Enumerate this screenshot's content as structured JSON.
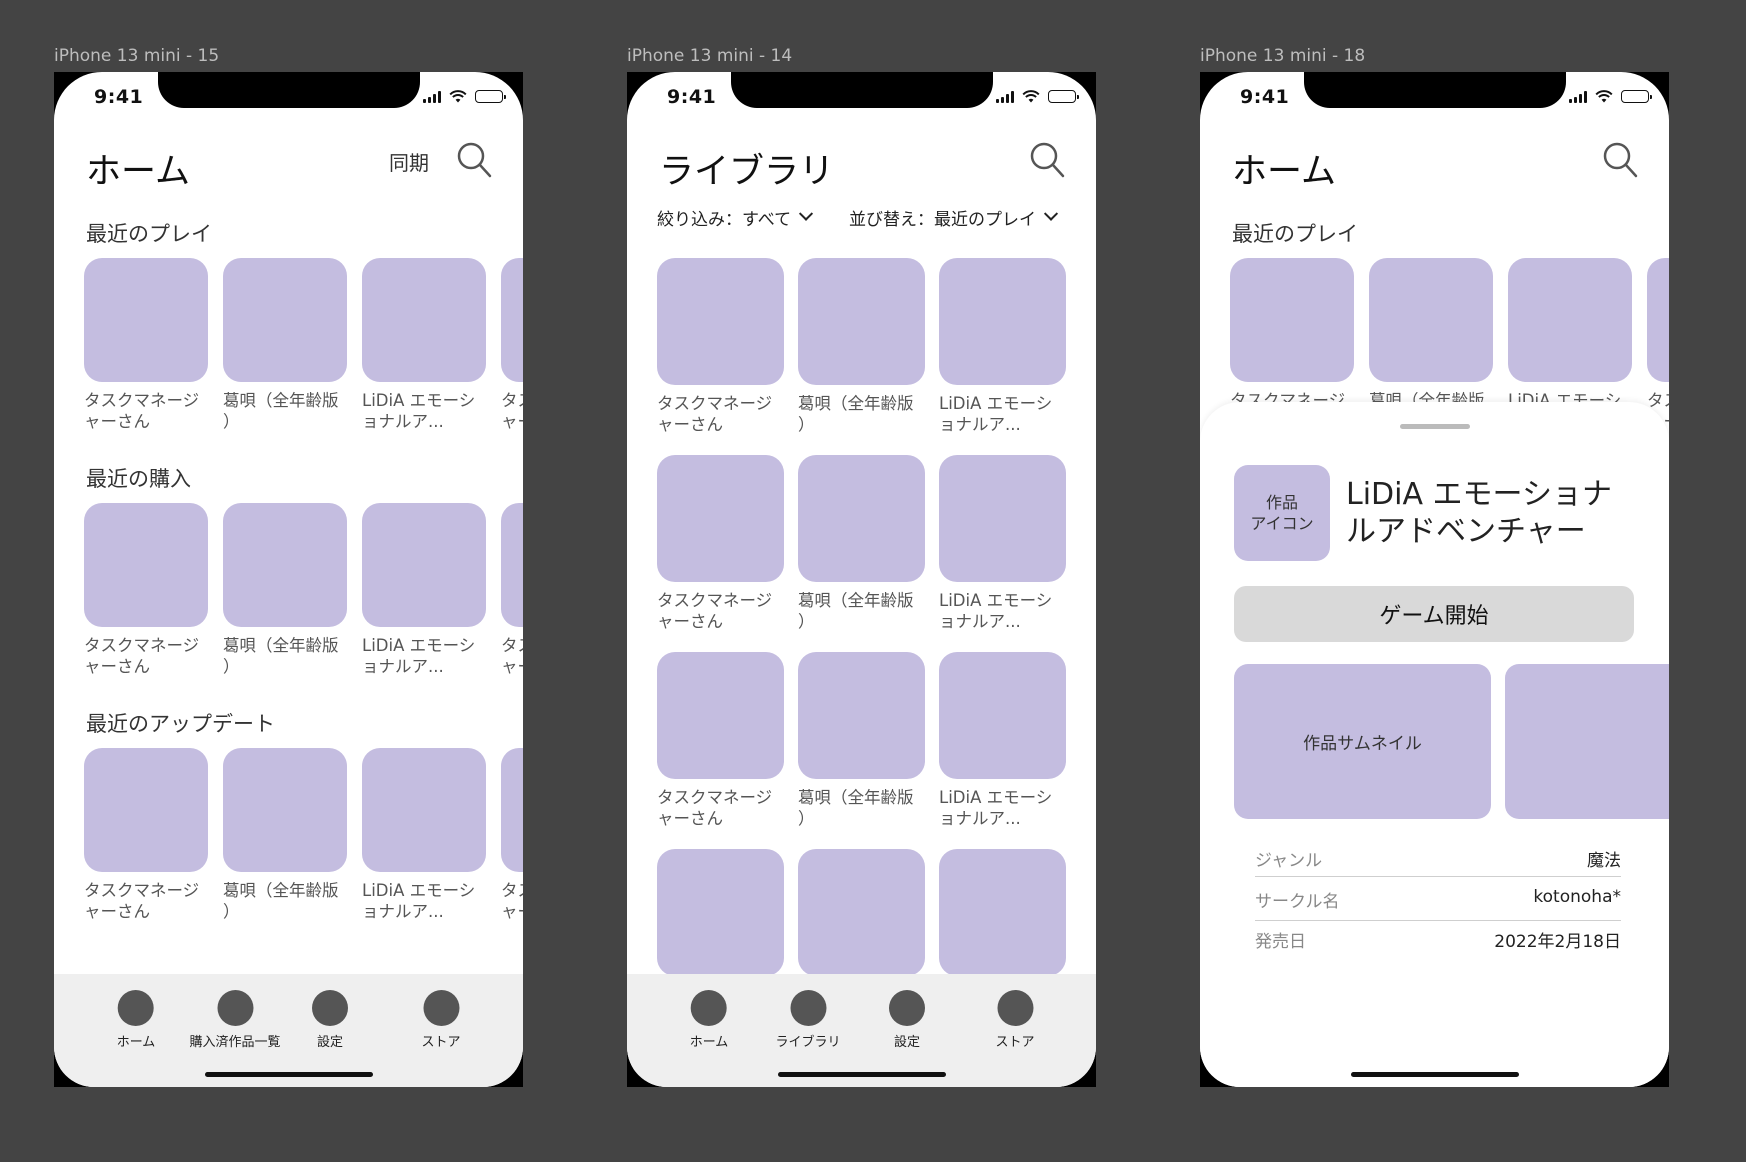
{
  "frames": [
    {
      "label": "iPhone 13 mini - 15"
    },
    {
      "label": "iPhone 13 mini - 14"
    },
    {
      "label": "iPhone 13 mini - 18"
    }
  ],
  "status": {
    "time": "9:41"
  },
  "home": {
    "title": "ホーム",
    "sync_label": "同期",
    "sections": [
      {
        "title": "最近のプレイ"
      },
      {
        "title": "最近の購入"
      },
      {
        "title": "最近のアップデート"
      }
    ],
    "tiles": [
      {
        "caption": "タスクマネージ\nャーさん"
      },
      {
        "caption": "葛唄（全年齢版\n）"
      },
      {
        "caption": "LiDiA エモーシ\nョナルア..."
      },
      {
        "caption": "タス\nャー"
      }
    ],
    "tabs": [
      {
        "label": "ホーム"
      },
      {
        "label": "購入済作品一覧"
      },
      {
        "label": "設定"
      },
      {
        "label": "ストア"
      }
    ]
  },
  "library": {
    "title": "ライブラリ",
    "filter_label": "絞り込み：すべて",
    "sort_label": "並び替え：最近のプレイ",
    "tiles": [
      {
        "caption": "タスクマネージ\nャーさん"
      },
      {
        "caption": "葛唄（全年齢版\n）"
      },
      {
        "caption": "LiDiA エモーシ\nョナルア..."
      }
    ],
    "tabs": [
      {
        "label": "ホーム"
      },
      {
        "label": "ライブラリ"
      },
      {
        "label": "設定"
      },
      {
        "label": "ストア"
      }
    ]
  },
  "detail": {
    "icon_label": "作品\nアイコン",
    "title": "LiDiA エモーショナ\nルアドベンチャー",
    "start_button": "ゲーム開始",
    "thumbnail_label": "作品サムネイル",
    "info": [
      {
        "key": "ジャンル",
        "value": "魔法"
      },
      {
        "key": "サークル名",
        "value": "kotonoha*"
      },
      {
        "key": "発売日",
        "value": "2022年2月18日"
      }
    ]
  },
  "colors": {
    "background": "#444444",
    "tile": "#c4bde0",
    "tabbar": "#efefef",
    "button": "#d9d9d9"
  }
}
